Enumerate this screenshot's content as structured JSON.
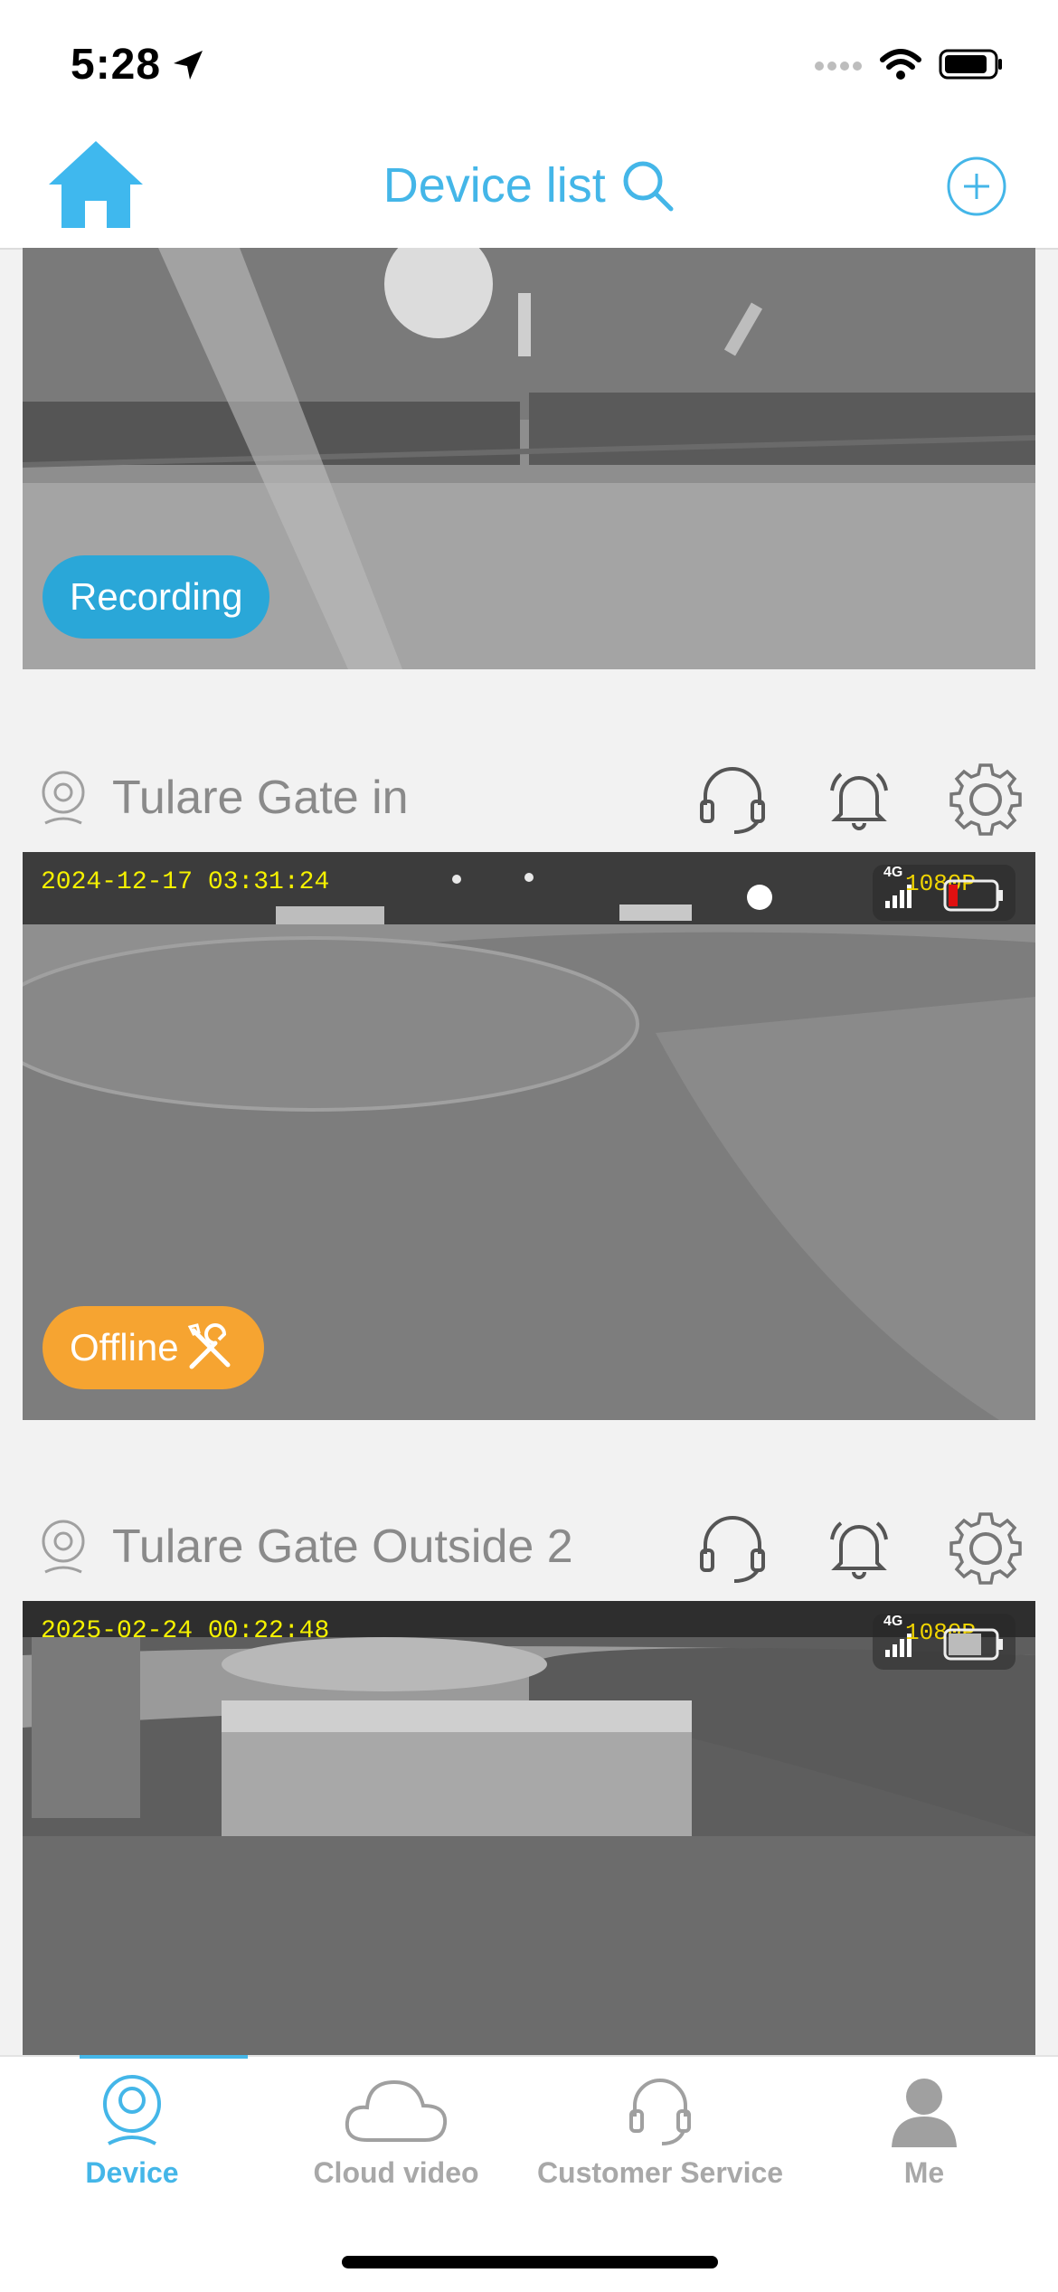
{
  "status_bar": {
    "time": "5:28"
  },
  "header": {
    "title": "Device list"
  },
  "feeds": [
    {
      "badge": "Recording"
    },
    {
      "device_name": "Tulare Gate in",
      "timestamp": "2024-12-17 03:31:24",
      "resolution": "1080P",
      "network": "4G",
      "badge": "Offline"
    },
    {
      "device_name": "Tulare Gate Outside 2",
      "timestamp": "2025-02-24 00:22:48",
      "resolution": "1080P",
      "network": "4G"
    }
  ],
  "tabs": [
    {
      "label": "Device",
      "active": true
    },
    {
      "label": "Cloud video"
    },
    {
      "label": "Customer Service"
    },
    {
      "label": "Me"
    }
  ],
  "colors": {
    "accent": "#44b6e8",
    "recording": "#2aa7d8",
    "offline": "#f6a431",
    "osd_text": "#f5f100"
  }
}
